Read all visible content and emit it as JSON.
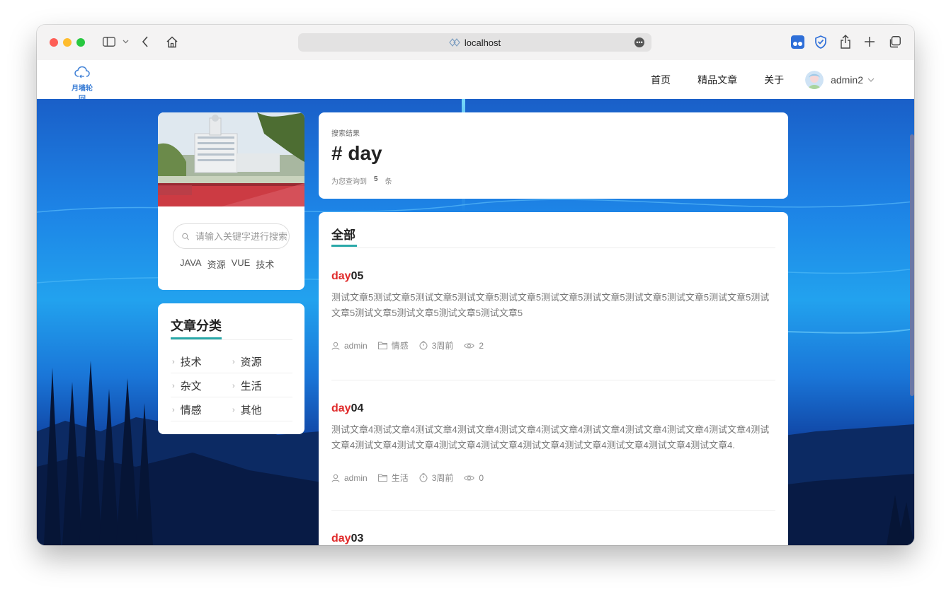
{
  "browser": {
    "url": "localhost"
  },
  "site": {
    "logo_text": "月墙轮回",
    "nav": [
      "首页",
      "精品文章",
      "关于"
    ],
    "user": "admin2"
  },
  "sidebar": {
    "search_placeholder": "请输入关键字进行搜索",
    "tags": [
      "JAVA",
      "资源",
      "VUE",
      "技术"
    ],
    "categories_title": "文章分类",
    "categories": [
      "技术",
      "资源",
      "杂文",
      "生活",
      "情感",
      "其他"
    ]
  },
  "search_result": {
    "label": "搜索结果",
    "title": "# day",
    "count_prefix": "为您查询到",
    "count": "5",
    "count_suffix": "条"
  },
  "list": {
    "tab": "全部",
    "posts": [
      {
        "highlight": "day",
        "rest": "05",
        "excerpt": "测试文章5测试文章5测试文章5测试文章5测试文章5测试文章5测试文章5测试文章5测试文章5测试文章5测试文章5测试文章5测试文章5测试文章5测试文章5",
        "author": "admin",
        "category": "情感",
        "time": "3周前",
        "views": "2"
      },
      {
        "highlight": "day",
        "rest": "04",
        "excerpt": "测试文章4测试文章4测试文章4测试文章4测试文章4测试文章4测试文章4测试文章4测试文章4测试文章4测试文章4测试文章4测试文章4测试文章4测试文章4测试文章4测试文章4测试文章4测试文章4测试文章4.",
        "author": "admin",
        "category": "生活",
        "time": "3周前",
        "views": "0"
      },
      {
        "highlight": "day",
        "rest": "03"
      }
    ]
  }
}
